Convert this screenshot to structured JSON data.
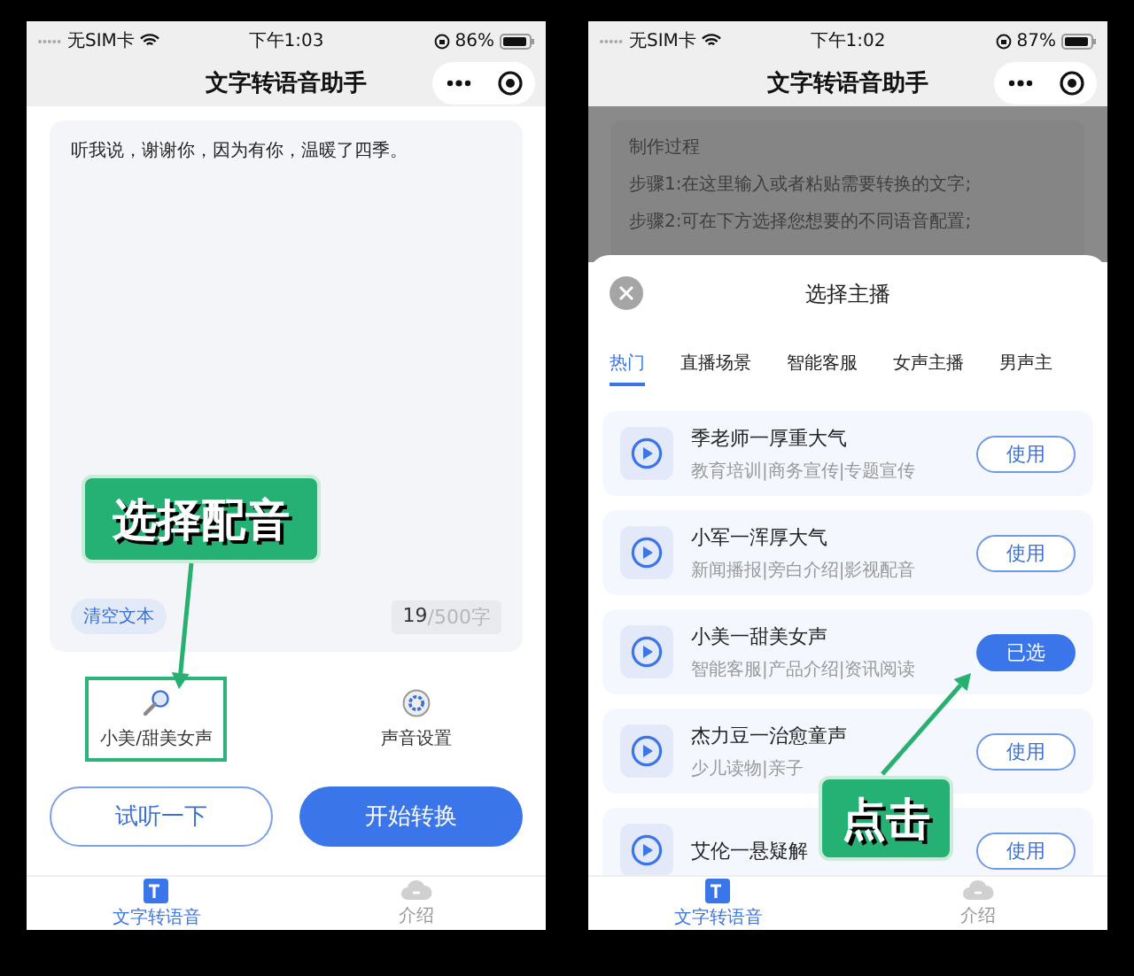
{
  "left_screen": {
    "status_bar": {
      "carrier": "无SIM卡",
      "time": "下午1:03",
      "battery": "86%"
    },
    "title": "文字转语音助手",
    "editor": {
      "text": "听我说，谢谢你，因为有你，温暖了四季。",
      "clear_button": "清空文本",
      "count": "19",
      "limit": "/500字"
    },
    "options": [
      {
        "kind": "voice",
        "label": "小美/甜美女声",
        "highlighted": true
      },
      {
        "kind": "settings",
        "label": "声音设置",
        "highlighted": false
      }
    ],
    "buttons": [
      {
        "kind": "outline",
        "label": "试听一下"
      },
      {
        "kind": "primary",
        "label": "开始转换"
      }
    ],
    "tab_bar": [
      {
        "kind": "convert",
        "label": "文字转语音",
        "selected": true
      },
      {
        "kind": "intro",
        "label": "介绍",
        "selected": false
      }
    ],
    "annotation": "选择配音"
  },
  "right_screen": {
    "status_bar": {
      "carrier": "无SIM卡",
      "time": "下午1:02",
      "battery": "87%"
    },
    "title": "文字转语音助手",
    "background_lines": [
      "制作过程",
      "步骤1:在这里输入或者粘贴需要转换的文字;",
      "步骤2:可在下方选择您想要的不同语音配置;"
    ],
    "sheet": {
      "title": "选择主播",
      "tabs": [
        {
          "label": "热门",
          "selected": true
        },
        {
          "label": "直播场景",
          "selected": false
        },
        {
          "label": "智能客服",
          "selected": false
        },
        {
          "label": "女声主播",
          "selected": false
        },
        {
          "label": "男声主",
          "selected": false
        }
      ],
      "voices": [
        {
          "name": "季老师一厚重大气",
          "tags": "教育培训|商务宣传|专题宣传",
          "button": "使用",
          "selected": false
        },
        {
          "name": "小军一浑厚大气",
          "tags": "新闻播报|旁白介绍|影视配音",
          "button": "使用",
          "selected": false
        },
        {
          "name": "小美一甜美女声",
          "tags": "智能客服|产品介绍|资讯阅读",
          "button": "已选",
          "selected": true
        },
        {
          "name": "杰力豆一治愈童声",
          "tags": "少儿读物|亲子",
          "button": "使用",
          "selected": false
        },
        {
          "name": "艾伦一悬疑解",
          "button": "使用",
          "selected": false
        }
      ]
    },
    "tab_bar": [
      {
        "kind": "convert",
        "label": "文字转语音",
        "selected": true
      },
      {
        "kind": "intro",
        "label": "介绍",
        "selected": false
      }
    ],
    "annotation": "点击"
  }
}
